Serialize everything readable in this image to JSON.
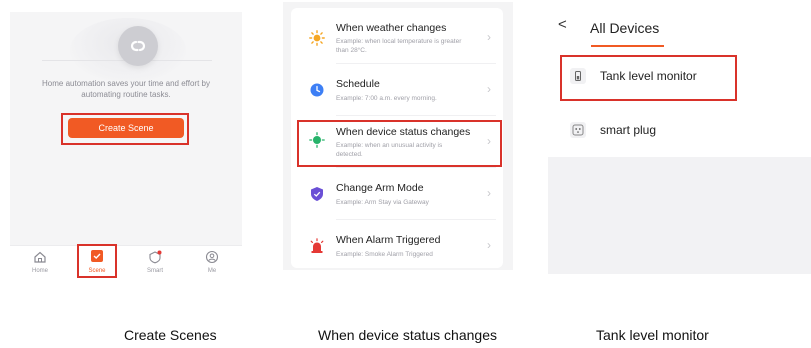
{
  "scene_panel": {
    "description": "Home automation saves your time and effort by automating routine tasks.",
    "create_button": "Create Scene",
    "tabs": [
      {
        "label": "Home",
        "icon": "home-icon"
      },
      {
        "label": "Scene",
        "icon": "scene-icon"
      },
      {
        "label": "Smart",
        "icon": "smart-icon"
      },
      {
        "label": "Me",
        "icon": "me-icon"
      }
    ],
    "accent": "#f15a24"
  },
  "condition_panel": {
    "items": [
      {
        "title": "When weather changes",
        "subtitle": "Example: when local temperature is greater than 28°C.",
        "icon": "sun-icon"
      },
      {
        "title": "Schedule",
        "subtitle": "Example: 7:00 a.m. every morning.",
        "icon": "clock-icon"
      },
      {
        "title": "When device status changes",
        "subtitle": "Example: when an unusual activity is detected.",
        "icon": "device-status-icon"
      },
      {
        "title": "Change Arm Mode",
        "subtitle": "Example: Arm Stay via Gateway",
        "icon": "shield-icon"
      },
      {
        "title": "When Alarm Triggered",
        "subtitle": "Example: Smoke Alarm Triggered",
        "icon": "alarm-icon"
      }
    ]
  },
  "devices_panel": {
    "back": "<",
    "title": "All Devices",
    "devices": [
      {
        "label": "Tank level monitor",
        "icon": "tank-monitor-icon"
      },
      {
        "label": "smart plug",
        "icon": "smart-plug-icon"
      }
    ]
  },
  "captions": [
    "Create Scenes",
    "When device status changes",
    "Tank level monitor"
  ],
  "highlight_color": "#d9322a"
}
